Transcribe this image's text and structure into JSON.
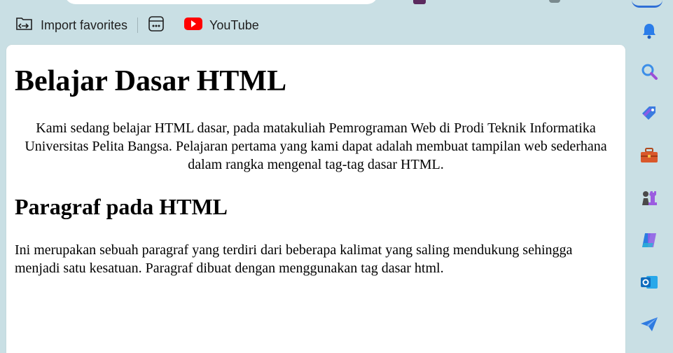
{
  "favorites_bar": {
    "items": [
      {
        "label": "Import favorites",
        "icon": "import-folder-icon"
      },
      {
        "label": "",
        "icon": "apps-icon"
      },
      {
        "label": "YouTube",
        "icon": "youtube-icon"
      }
    ]
  },
  "page": {
    "heading1": "Belajar Dasar HTML",
    "intro": "Kami sedang belajar HTML dasar, pada matakuliah Pemrograman Web di Prodi Teknik Informatika Universitas Pelita Bangsa. Pelajaran pertama yang kami dapat adalah membuat tampilan web sederhana dalam rangka mengenal tag-tag dasar HTML.",
    "heading2": "Paragraf pada HTML",
    "paragraph": "Ini merupakan sebuah paragraf yang terdiri dari beberapa kalimat yang saling mendukung sehingga menjadi satu kesatuan. Paragraf dibuat dengan menggunakan tag dasar html."
  },
  "sidebar": {
    "items": [
      "bell-icon",
      "search-icon",
      "tag-icon",
      "toolbox-icon",
      "chess-icon",
      "copilot-icon",
      "outlook-icon",
      "send-icon"
    ]
  },
  "colors": {
    "chrome_bg": "#c9dfe4",
    "youtube_red": "#ff0000",
    "accent_blue": "#1a73e8"
  }
}
